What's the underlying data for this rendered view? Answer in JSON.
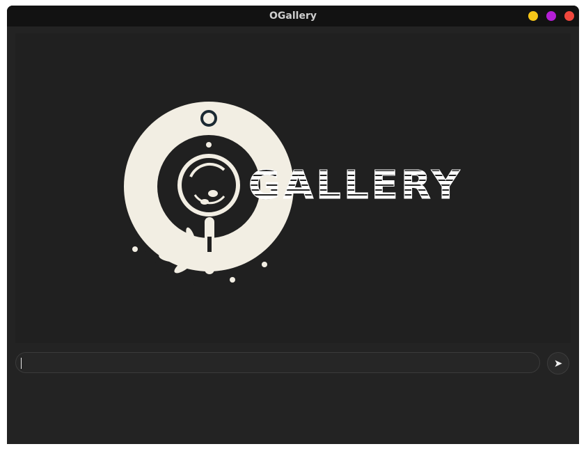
{
  "window": {
    "title": "OGallery",
    "controls": [
      {
        "name": "minimize",
        "color": "#f5c518"
      },
      {
        "name": "maximize",
        "color": "#b41fd6"
      },
      {
        "name": "close",
        "color": "#f0473d"
      }
    ]
  },
  "logo": {
    "text": "GALLERY",
    "background_color": "#f2eee3",
    "accent_color": "#1c2a33"
  },
  "chat": {
    "input_value": "",
    "input_placeholder": "",
    "send_icon": "send-arrow-icon",
    "send_glyph": "➤"
  }
}
